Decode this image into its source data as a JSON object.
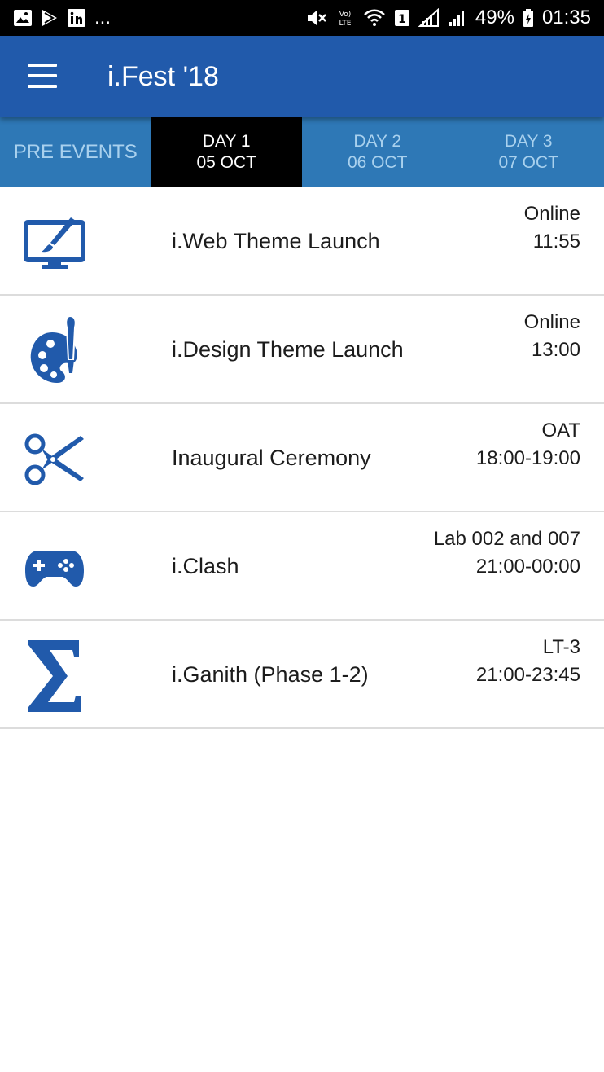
{
  "status_bar": {
    "left_icons": [
      "gallery-icon",
      "play-store-icon",
      "linkedin-icon"
    ],
    "overflow": "...",
    "right_icons": [
      "mute-icon",
      "volte-icon",
      "wifi-icon",
      "sim-icon",
      "signal-icon",
      "signal-icon"
    ],
    "battery": "49%",
    "time": "01:35"
  },
  "app_bar": {
    "menu_icon": "hamburger-menu-icon",
    "title": "i.Fest '18"
  },
  "tabs": [
    {
      "line1": "PRE EVENTS",
      "line2": ""
    },
    {
      "line1": "DAY 1",
      "line2": "05 OCT",
      "selected": true
    },
    {
      "line1": "DAY 2",
      "line2": "06 OCT"
    },
    {
      "line1": "DAY 3",
      "line2": "07 OCT"
    }
  ],
  "events": [
    {
      "icon": "monitor-brush-icon",
      "name": "i.Web Theme Launch",
      "venue": "Online",
      "time": "11:55"
    },
    {
      "icon": "palette-icon",
      "name": "i.Design Theme Launch",
      "venue": "Online",
      "time": "13:00"
    },
    {
      "icon": "scissors-icon",
      "name": "Inaugural Ceremony",
      "venue": "OAT",
      "time": "18:00-19:00"
    },
    {
      "icon": "gamepad-icon",
      "name": "i.Clash",
      "venue": "Lab 002 and 007",
      "time": "21:00-00:00"
    },
    {
      "icon": "sigma-icon",
      "name": "i.Ganith (Phase 1-2)",
      "venue": "LT-3",
      "time": "21:00-23:45"
    }
  ],
  "colors": {
    "app_bar": "#215aab",
    "tab_bar": "#2e78b6",
    "tab_active": "#000000",
    "icon_blue": "#215aab"
  }
}
